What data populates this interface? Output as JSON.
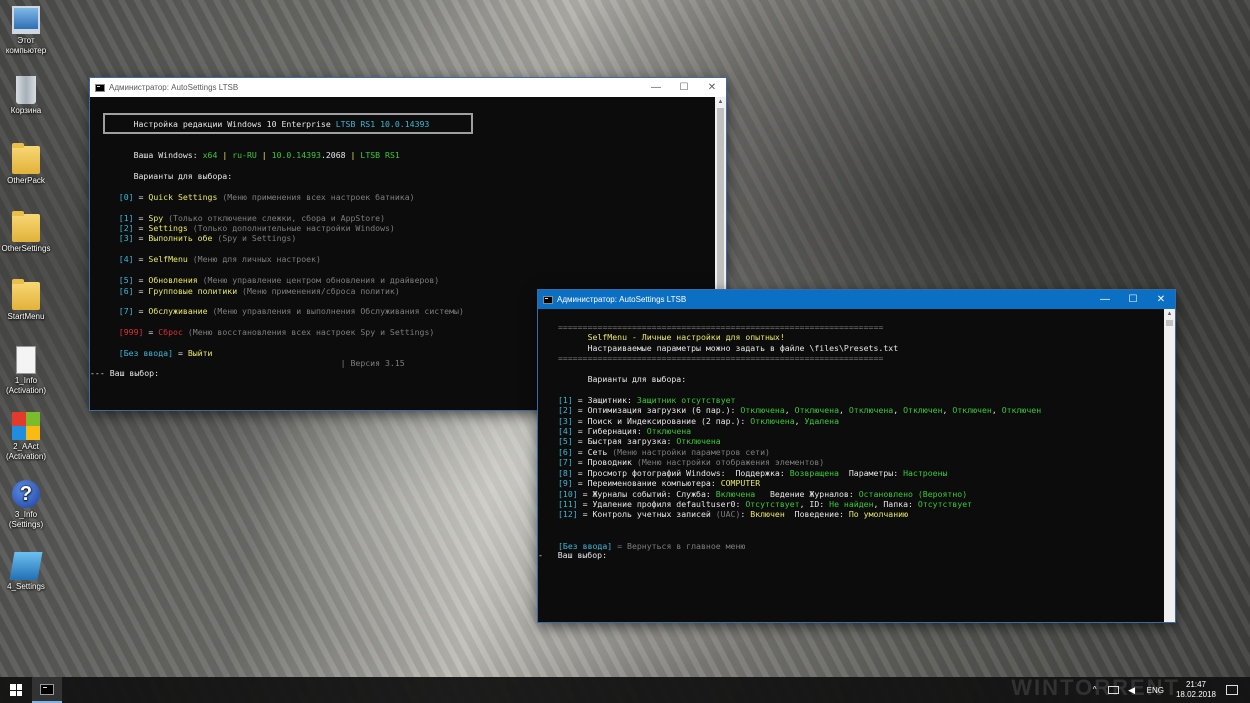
{
  "desktop": {
    "icons": [
      {
        "label": "Этот компьютер",
        "icon": "computer-icon"
      },
      {
        "label": "Корзина",
        "icon": "recycle-bin-icon"
      },
      {
        "label": "OtherPack",
        "icon": "folder-icon"
      },
      {
        "label": "OtherSettings",
        "icon": "folder-icon"
      },
      {
        "label": "StartMenu",
        "icon": "folder-icon"
      },
      {
        "label": "1_Info (Activation)",
        "icon": "document-icon"
      },
      {
        "label": "2_AAct (Activation)",
        "icon": "windows-logo-icon"
      },
      {
        "label": "3_Info (Settings)",
        "icon": "help-icon"
      },
      {
        "label": "4_Settings",
        "icon": "settings-icon"
      }
    ]
  },
  "window1": {
    "title": "Администратор:  AutoSettings LTSB",
    "minimize": "—",
    "maximize": "☐",
    "close": "✕",
    "header": {
      "a": "Настройка редакции ",
      "b": "Windows 10 Enterprise ",
      "c": "LTSB RS1 10.0.14393"
    },
    "info": {
      "label": "Ваша Windows: ",
      "arch": "x64",
      "sep": " | ",
      "lang": "ru-RU",
      "build": "10.0.14393",
      "rev": ".2068",
      "edition": "LTSB RS1"
    },
    "choose": "Варианты для выбора:",
    "items": [
      {
        "key": "[0]",
        "eq": " = ",
        "name": "Quick Settings",
        "desc": " (Меню применения всех настроек батника)"
      },
      {
        "key": "[1]",
        "eq": " = ",
        "name": "Spy",
        "desc": " (Только отключение слежки, сбора и AppStore)"
      },
      {
        "key": "[2]",
        "eq": " = ",
        "name": "Settings",
        "desc": " (Только дополнительные настройки Windows)"
      },
      {
        "key": "[3]",
        "eq": " = ",
        "name": "Выполнить обе",
        "desc": " (Spy и Settings)"
      },
      {
        "key": "[4]",
        "eq": " = ",
        "name": "SelfMenu",
        "desc": " (Меню для личных настроек)"
      },
      {
        "key": "[5]",
        "eq": " = ",
        "name": "Обновления",
        "desc": " (Меню управление центром обновления и драйверов)"
      },
      {
        "key": "[6]",
        "eq": " = ",
        "name": "Групповые политики",
        "desc": " (Меню применения/сброса политик)"
      },
      {
        "key": "[7]",
        "eq": " = ",
        "name": "Обслуживание",
        "desc": " (Меню управления и выполнения Обслуживания системы)"
      },
      {
        "key": "[999]",
        "eq": " = ",
        "name": "Сброс",
        "desc": " (Меню восстановления всех настроек Spy и Settings)"
      }
    ],
    "noinput": {
      "key": "[Без ввода]",
      "eq": " = ",
      "name": "Выйти"
    },
    "version": "| Версия 3.15",
    "prompt": "--- Ваш выбор:"
  },
  "window2": {
    "title": "Администратор:  AutoSettings LTSB",
    "minimize": "—",
    "maximize": "☐",
    "close": "✕",
    "rule": "==================================================================",
    "head1": "SelfMenu - Личные настройки для опытных!",
    "head2a": "Настраиваемые параметры можно задать в файле ",
    "head2b": "\\files\\Presets.txt",
    "choose": "Варианты для выбора:",
    "items": [
      {
        "key": "[1]",
        "parts": [
          {
            "t": " = Защитник: ",
            "c": "wh"
          },
          {
            "t": "Защитник отсутствует",
            "c": "gr"
          }
        ]
      },
      {
        "key": "[2]",
        "parts": [
          {
            "t": " = Оптимизация загрузки (6 пар.): ",
            "c": "wh"
          },
          {
            "t": "Отключена",
            "c": "gr"
          },
          {
            "t": ", ",
            "c": "wh"
          },
          {
            "t": "Отключена",
            "c": "gr"
          },
          {
            "t": ", ",
            "c": "wh"
          },
          {
            "t": "Отключена",
            "c": "gr"
          },
          {
            "t": ", ",
            "c": "wh"
          },
          {
            "t": "Отключен",
            "c": "gr"
          },
          {
            "t": ", ",
            "c": "wh"
          },
          {
            "t": "Отключен",
            "c": "gr"
          },
          {
            "t": ", ",
            "c": "wh"
          },
          {
            "t": "Отключен",
            "c": "gr"
          }
        ]
      },
      {
        "key": "[3]",
        "parts": [
          {
            "t": " = Поиск и Индексирование (2 пар.): ",
            "c": "wh"
          },
          {
            "t": "Отключена",
            "c": "gr"
          },
          {
            "t": ", ",
            "c": "wh"
          },
          {
            "t": "Удалена",
            "c": "gr"
          }
        ]
      },
      {
        "key": "[4]",
        "parts": [
          {
            "t": " = Гибернация: ",
            "c": "wh"
          },
          {
            "t": "Отключена",
            "c": "gr"
          }
        ]
      },
      {
        "key": "[5]",
        "parts": [
          {
            "t": " = Быстрая загрузка: ",
            "c": "wh"
          },
          {
            "t": "Отключена",
            "c": "gr"
          }
        ]
      },
      {
        "key": "[6]",
        "parts": [
          {
            "t": " = Сеть ",
            "c": "wh"
          },
          {
            "t": "(Меню настройки параметров сети)",
            "c": "gy"
          }
        ]
      },
      {
        "key": "[7]",
        "parts": [
          {
            "t": " = Проводник ",
            "c": "wh"
          },
          {
            "t": "(Меню настройки отображения элементов)",
            "c": "gy"
          }
        ]
      },
      {
        "key": "[8]",
        "parts": [
          {
            "t": " = Просмотр фотографий Windows:  Поддержка: ",
            "c": "wh"
          },
          {
            "t": "Возвращена",
            "c": "gr"
          },
          {
            "t": "  Параметры: ",
            "c": "wh"
          },
          {
            "t": "Настроены",
            "c": "gr"
          }
        ]
      },
      {
        "key": "[9]",
        "parts": [
          {
            "t": " = Переименование компьютера: ",
            "c": "wh"
          },
          {
            "t": "COMPUTER",
            "c": "ye"
          }
        ]
      },
      {
        "key": "[10]",
        "parts": [
          {
            "t": " = Журналы событий: Служба: ",
            "c": "wh"
          },
          {
            "t": "Включена",
            "c": "gr"
          },
          {
            "t": "   Ведение Журналов: ",
            "c": "wh"
          },
          {
            "t": "Остановлено (Вероятно)",
            "c": "gr"
          }
        ]
      },
      {
        "key": "[11]",
        "parts": [
          {
            "t": " = Удаление профиля defaultuser0: ",
            "c": "wh"
          },
          {
            "t": "Отсутствует",
            "c": "gr"
          },
          {
            "t": ", ID: ",
            "c": "wh"
          },
          {
            "t": "Не найден",
            "c": "gr"
          },
          {
            "t": ", Папка: ",
            "c": "wh"
          },
          {
            "t": "Отсутствует",
            "c": "gr"
          }
        ]
      },
      {
        "key": "[12]",
        "parts": [
          {
            "t": " = Контроль учетных записей ",
            "c": "wh"
          },
          {
            "t": "(UAC)",
            "c": "gy"
          },
          {
            "t": ": ",
            "c": "wh"
          },
          {
            "t": "Включен",
            "c": "ye"
          },
          {
            "t": "  Поведение: ",
            "c": "wh"
          },
          {
            "t": "По умолчанию",
            "c": "ye"
          }
        ]
      }
    ],
    "noinput": {
      "key": "[Без ввода]",
      "rest": " = Вернуться в главное меню"
    },
    "prompt_dash": "-",
    "prompt": "Ваш выбор:"
  },
  "taskbar": {
    "tray_language": "ENG",
    "time": "21:47",
    "date": "18.02.2018",
    "watermark": "WINTORRENT"
  },
  "colors": {
    "accent": "#0b6fc4",
    "cyan": "#3ab8d8",
    "yellow": "#e8e864",
    "green": "#39c839",
    "red": "#d63131"
  }
}
